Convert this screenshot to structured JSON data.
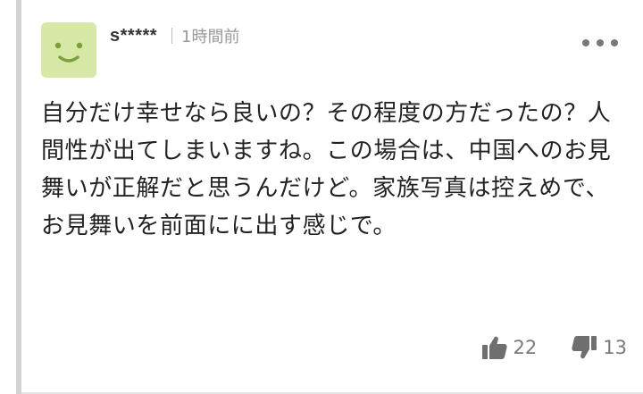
{
  "comment": {
    "author": "s*****",
    "timestamp": "1時間前",
    "body": "自分だけ幸せなら良いの？その程度の方だったの？人間性が出てしまいますね。この場合は、中国へのお見舞いが正解だと思うんだけど。家族写真は控えめで、お見舞いを前面にに出す感じで。",
    "avatar_icon": "smiley-face-icon",
    "more_icon": "more-dots-icon"
  },
  "reactions": {
    "like": {
      "icon": "thumbs-up-icon",
      "count": "22"
    },
    "dislike": {
      "icon": "thumbs-down-icon",
      "count": "13"
    }
  },
  "colors": {
    "avatar_bg": "#d7e7a6",
    "avatar_face": "#7ea03a",
    "muted_text": "#9a9a9a",
    "icon_gray": "#777777"
  }
}
